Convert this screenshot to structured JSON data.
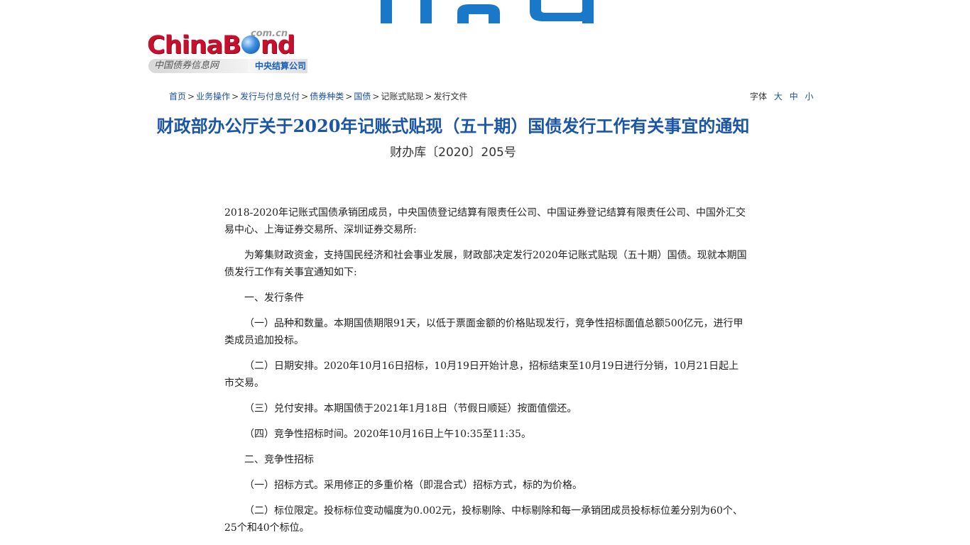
{
  "banner": {
    "color": "#1a78c8"
  },
  "logo": {
    "main_text": "ChinaBond",
    "domain": "com.cn",
    "sub_cn": "中国债券信息网",
    "sub_org": "中央结算公司",
    "brand_red": "#c8102e",
    "brand_blue": "#1a5fb4"
  },
  "breadcrumb": {
    "items": [
      {
        "label": "首页",
        "link": true
      },
      {
        "label": "业务操作",
        "link": true
      },
      {
        "label": "发行与付息兑付",
        "link": true
      },
      {
        "label": "债券种类",
        "link": true
      },
      {
        "label": "国债",
        "link": true
      },
      {
        "label": "记账式贴现",
        "link": false
      },
      {
        "label": "发行文件",
        "link": false
      }
    ],
    "separator": ">"
  },
  "font_size": {
    "label": "字体",
    "large": "大",
    "medium": "中",
    "small": "小"
  },
  "article": {
    "title": "财政部办公厅关于2020年记账式贴现（五十期）国债发行工作有关事宜的通知",
    "doc_number": "财办库〔2020〕205号",
    "paragraphs": [
      {
        "text": "2018-2020年记账式国债承销团成员，中央国债登记结算有限责任公司、中国证券登记结算有限责任公司、中国外汇交易中心、上海证券交易所、深圳证券交易所:",
        "indent": false
      },
      {
        "text": "为筹集财政资金，支持国民经济和社会事业发展，财政部决定发行2020年记账式贴现（五十期）国债。现就本期国债发行工作有关事宜通知如下:",
        "indent": true
      },
      {
        "text": "一、发行条件",
        "indent": true
      },
      {
        "text": "（一）品种和数量。本期国债期限91天，以低于票面金额的价格贴现发行，竞争性招标面值总额500亿元，进行甲类成员追加投标。",
        "indent": true
      },
      {
        "text": "（二）日期安排。2020年10月16日招标，10月19日开始计息，招标结束至10月19日进行分销，10月21日起上市交易。",
        "indent": true
      },
      {
        "text": "（三）兑付安排。本期国债于2021年1月18日（节假日顺延）按面值偿还。",
        "indent": true
      },
      {
        "text": "（四）竞争性招标时间。2020年10月16日上午10:35至11:35。",
        "indent": true
      },
      {
        "text": "二、竞争性招标",
        "indent": true
      },
      {
        "text": "（一）招标方式。采用修正的多重价格（即混合式）招标方式，标的为价格。",
        "indent": true
      },
      {
        "text": "（二）标位限定。投标标位变动幅度为0.002元，投标剔除、中标剔除和每一承销团成员投标标位差分别为60个、25个和40个标位。",
        "indent": true
      }
    ]
  }
}
